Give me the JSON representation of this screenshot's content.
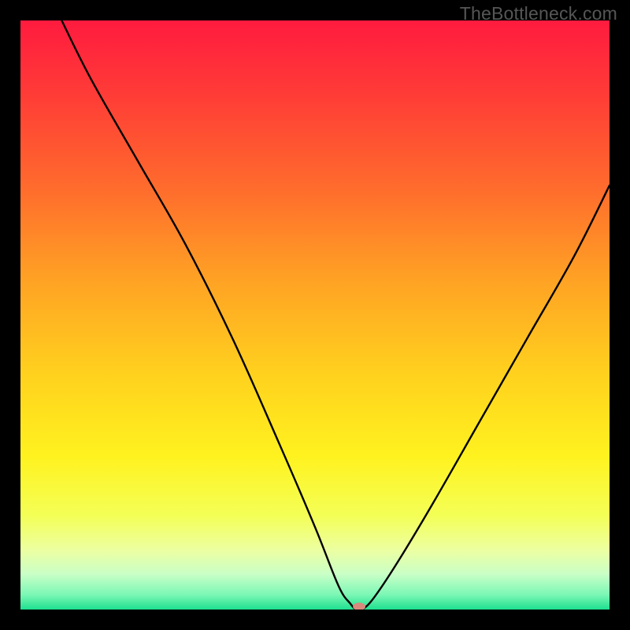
{
  "watermark": "TheBottleneck.com",
  "chart_data": {
    "type": "line",
    "title": "",
    "xlabel": "",
    "ylabel": "",
    "xlim": [
      0,
      100
    ],
    "ylim": [
      0,
      100
    ],
    "grid": false,
    "legend": false,
    "series": [
      {
        "name": "curve",
        "x": [
          7,
          12,
          20,
          28,
          36,
          44,
          50,
          54,
          56,
          57,
          58,
          60,
          64,
          70,
          78,
          86,
          94,
          100
        ],
        "values": [
          100,
          90,
          76,
          62,
          46,
          28,
          14,
          4,
          1,
          0,
          0,
          2,
          8,
          18,
          32,
          46,
          60,
          72
        ]
      }
    ],
    "marker": {
      "x": 57.5,
      "y": 0.5,
      "color": "#d88a7d",
      "rx": 8,
      "ry": 5
    },
    "gradient_stops": [
      {
        "offset": 0.0,
        "color": "#ff1b3f"
      },
      {
        "offset": 0.12,
        "color": "#ff3a37"
      },
      {
        "offset": 0.28,
        "color": "#ff6a2d"
      },
      {
        "offset": 0.44,
        "color": "#ffa224"
      },
      {
        "offset": 0.6,
        "color": "#ffd11e"
      },
      {
        "offset": 0.74,
        "color": "#fff21f"
      },
      {
        "offset": 0.84,
        "color": "#f4ff56"
      },
      {
        "offset": 0.9,
        "color": "#ecffa2"
      },
      {
        "offset": 0.94,
        "color": "#c9ffc7"
      },
      {
        "offset": 0.975,
        "color": "#7bf7b5"
      },
      {
        "offset": 1.0,
        "color": "#1ee08f"
      }
    ]
  }
}
